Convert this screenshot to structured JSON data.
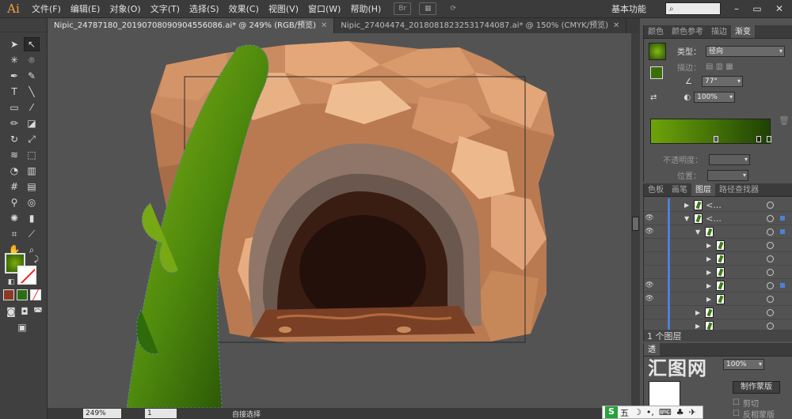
{
  "menubar": {
    "app_logo": "Ai",
    "items": [
      "文件(F)",
      "编辑(E)",
      "对象(O)",
      "文字(T)",
      "选择(S)",
      "效果(C)",
      "视图(V)",
      "窗口(W)",
      "帮助(H)"
    ],
    "bridge_label": "Br",
    "workspace": "基本功能",
    "search_placeholder": ""
  },
  "tabs": [
    {
      "label": "Nipic_24787180_20190708090904556086.ai* @ 249% (RGB/预览)",
      "active": true
    },
    {
      "label": "Nipic_27404474_20180818232531744087.ai* @ 150% (CMYK/预览)",
      "active": false
    }
  ],
  "statusbar": {
    "zoom": "249%",
    "page": "1",
    "status_text": "自接选择"
  },
  "gradient_panel": {
    "tabs": [
      "颜色",
      "颜色参考",
      "描边",
      "渐变"
    ],
    "active_tab": "渐变",
    "type_label": "类型：",
    "type_value": "径向",
    "stroke_label": "描边：",
    "angle_value": "77°",
    "aspect_value": "100%",
    "opacity_label": "不透明度：",
    "location_label": "位置：",
    "colors": {
      "start": "#6fa30a",
      "end": "#1f4104"
    }
  },
  "layers_panel": {
    "tabs": [
      "色板",
      "画笔",
      "图层",
      "路径查找器"
    ],
    "active_tab": "图层",
    "rows": [
      {
        "name": "<...",
        "indent": 0,
        "visible": false,
        "expanded": false
      },
      {
        "name": "<...",
        "indent": 0,
        "visible": true,
        "expanded": true
      },
      {
        "name": "",
        "indent": 1,
        "visible": true,
        "expanded": true
      },
      {
        "name": "",
        "indent": 2,
        "visible": false,
        "expanded": false
      },
      {
        "name": "",
        "indent": 2,
        "visible": false,
        "expanded": false
      },
      {
        "name": "",
        "indent": 2,
        "visible": false,
        "expanded": false
      },
      {
        "name": "",
        "indent": 2,
        "visible": true,
        "expanded": false,
        "selected": true
      },
      {
        "name": "",
        "indent": 2,
        "visible": true,
        "expanded": false
      },
      {
        "name": "",
        "indent": 1,
        "visible": false,
        "expanded": false
      },
      {
        "name": "",
        "indent": 1,
        "visible": false,
        "expanded": false
      }
    ],
    "footer": "1 个图层"
  },
  "transparency_panel": {
    "value": "100%",
    "make_mask_button": "制作蒙版",
    "clip_label": "剪切",
    "invert_label": "反相蒙版"
  },
  "ime": {
    "label": "五"
  },
  "watermark": "汇图网"
}
